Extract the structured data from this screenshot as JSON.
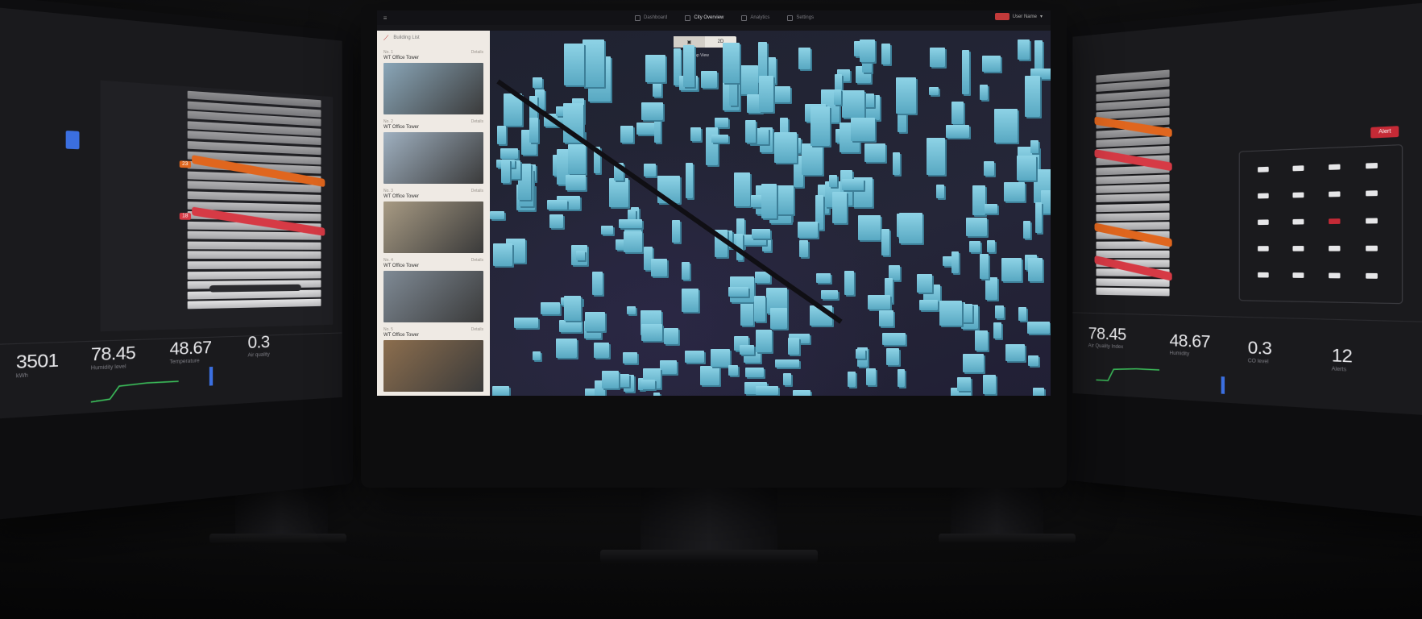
{
  "center": {
    "topbar": {
      "brand": "≡",
      "tabs": [
        {
          "label": "Dashboard",
          "active": false
        },
        {
          "label": "City Overview",
          "active": true
        },
        {
          "label": "Analytics",
          "active": false
        },
        {
          "label": "Settings",
          "active": false
        }
      ],
      "user": "User Name"
    },
    "sidebar": {
      "header": "Building List",
      "cards": [
        {
          "id": "No. 1",
          "title": "WT Office Tower",
          "tag": "Details",
          "thumb_color": "#8aa6b8"
        },
        {
          "id": "No. 2",
          "title": "WT Office Tower",
          "tag": "Details",
          "thumb_color": "#9fb0c0"
        },
        {
          "id": "No. 3",
          "title": "WT Office Tower",
          "tag": "Details",
          "thumb_color": "#a79a83"
        },
        {
          "id": "No. 4",
          "title": "WT Office Tower",
          "tag": "Details",
          "thumb_color": "#7f8a95"
        },
        {
          "id": "No. 5",
          "title": "WT Office Tower",
          "tag": "Details",
          "thumb_color": "#8c6e4e"
        }
      ]
    },
    "map": {
      "toggle": [
        "▣",
        "2D"
      ],
      "label": "Map View"
    }
  },
  "left": {
    "tags": [
      "23",
      "18"
    ],
    "stats": [
      {
        "value": "3501",
        "label": "kWh"
      },
      {
        "value": "78.45",
        "label": "Humidity level"
      },
      {
        "value": "48.67",
        "label": "Temperature"
      },
      {
        "value": "0.3",
        "label": "Air quality"
      }
    ],
    "band_colors": [
      "#e0661e",
      "#d63a45"
    ],
    "accent": "#3b6fe0"
  },
  "right": {
    "tag": "Alert",
    "stats": [
      {
        "value": "78.45",
        "label": "Air Quality Index"
      },
      {
        "value": "48.67",
        "label": "Humidity"
      },
      {
        "value": "0.3",
        "label": "CO level"
      },
      {
        "value": "12",
        "label": "Alerts"
      }
    ],
    "band_colors": [
      "#e0661e",
      "#d63a45"
    ],
    "accent": "#c52a36"
  }
}
